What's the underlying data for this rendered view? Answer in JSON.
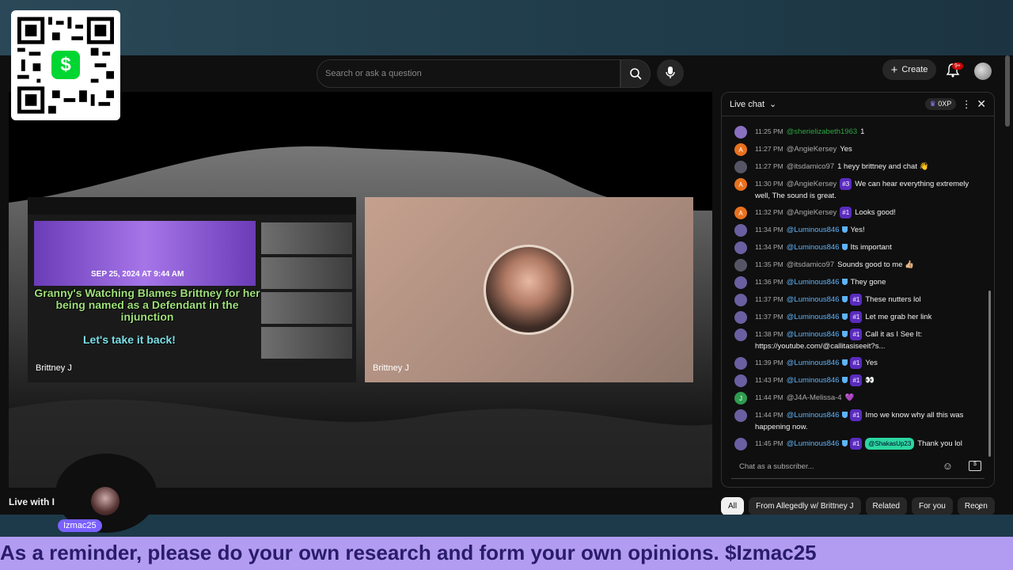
{
  "header": {
    "search_placeholder": "Search or ask a question",
    "create_label": "Create",
    "notification_count": "9+"
  },
  "player": {
    "left_tile_name": "Brittney J",
    "right_tile_name": "Brittney J",
    "shared_screen": {
      "date": "SEP 25, 2024 AT 9:44 AM",
      "headline": "Granny's Watching Blames Brittney for her being named as a Defendant in the injunction",
      "cta": "Let's take it back!"
    },
    "title": "Live with I"
  },
  "chat": {
    "header_label": "Live chat",
    "xp_label": "0XP",
    "input_placeholder": "Chat as a subscriber...",
    "messages": [
      {
        "time": "11:25 PM",
        "author": "@sherielizabeth1963",
        "badge": "",
        "text": "1",
        "avatar_color": "#8a70c0",
        "style": "green"
      },
      {
        "time": "11:27 PM",
        "author": "@AngieKersey",
        "badge": "",
        "text": "Yes",
        "avatar_color": "#e8711f",
        "style": "plain",
        "initial": "A"
      },
      {
        "time": "11:27 PM",
        "author": "@itsdamico97",
        "badge": "",
        "text": "1 heyy brittney and chat 👋",
        "avatar_color": "#556",
        "style": "plain"
      },
      {
        "time": "11:30 PM",
        "author": "@AngieKersey",
        "badge": "#3",
        "text": "We can hear everything extremely well, The sound is great.",
        "avatar_color": "#e8711f",
        "style": "plain",
        "initial": "A"
      },
      {
        "time": "11:32 PM",
        "author": "@AngieKersey",
        "badge": "#1",
        "text": "Looks good!",
        "avatar_color": "#e8711f",
        "style": "plain",
        "initial": "A"
      },
      {
        "time": "11:34 PM",
        "author": "@Luminous846",
        "badge": "",
        "text": "Yes!",
        "avatar_color": "#6a5fa0",
        "style": "member"
      },
      {
        "time": "11:34 PM",
        "author": "@Luminous846",
        "badge": "",
        "text": "Its important",
        "avatar_color": "#6a5fa0",
        "style": "member"
      },
      {
        "time": "11:35 PM",
        "author": "@itsdamico97",
        "badge": "",
        "text": "Sounds good to me 👍🏼",
        "avatar_color": "#556",
        "style": "plain"
      },
      {
        "time": "11:36 PM",
        "author": "@Luminous846",
        "badge": "",
        "text": "They gone",
        "avatar_color": "#6a5fa0",
        "style": "member"
      },
      {
        "time": "11:37 PM",
        "author": "@Luminous846",
        "badge": "#1",
        "text": "These nutters lol",
        "avatar_color": "#6a5fa0",
        "style": "member"
      },
      {
        "time": "11:37 PM",
        "author": "@Luminous846",
        "badge": "#1",
        "text": "Let me grab her link",
        "avatar_color": "#6a5fa0",
        "style": "member"
      },
      {
        "time": "11:38 PM",
        "author": "@Luminous846",
        "badge": "#1",
        "text": "Call it as I See It: https://youtube.com/@callitasiseeit?s...",
        "avatar_color": "#6a5fa0",
        "style": "member"
      },
      {
        "time": "11:39 PM",
        "author": "@Luminous846",
        "badge": "#1",
        "text": "Yes",
        "avatar_color": "#6a5fa0",
        "style": "member"
      },
      {
        "time": "11:43 PM",
        "author": "@Luminous846",
        "badge": "#1",
        "text": "👀",
        "avatar_color": "#6a5fa0",
        "style": "member"
      },
      {
        "time": "11:44 PM",
        "author": "@J4A-Melissa-4",
        "badge": "",
        "text": "💜",
        "avatar_color": "#2e9c4f",
        "style": "plain",
        "initial": "J"
      },
      {
        "time": "11:44 PM",
        "author": "@Luminous846",
        "badge": "#1",
        "text": "Imo we know why all this was happening now.",
        "avatar_color": "#6a5fa0",
        "style": "member"
      },
      {
        "time": "11:45 PM",
        "author": "@Luminous846",
        "badge": "#1",
        "mention": "@ShakasUp23",
        "text": "Thank you lol",
        "avatar_color": "#6a5fa0",
        "style": "member"
      }
    ]
  },
  "chips": [
    "All",
    "From Allegedly w/ Brittney J",
    "Related",
    "For you",
    "Recen"
  ],
  "overlay": {
    "streamer_tag": "Izmac25",
    "ticker": "As a reminder, please do your own research and form your own opinions. $Izmac25"
  }
}
